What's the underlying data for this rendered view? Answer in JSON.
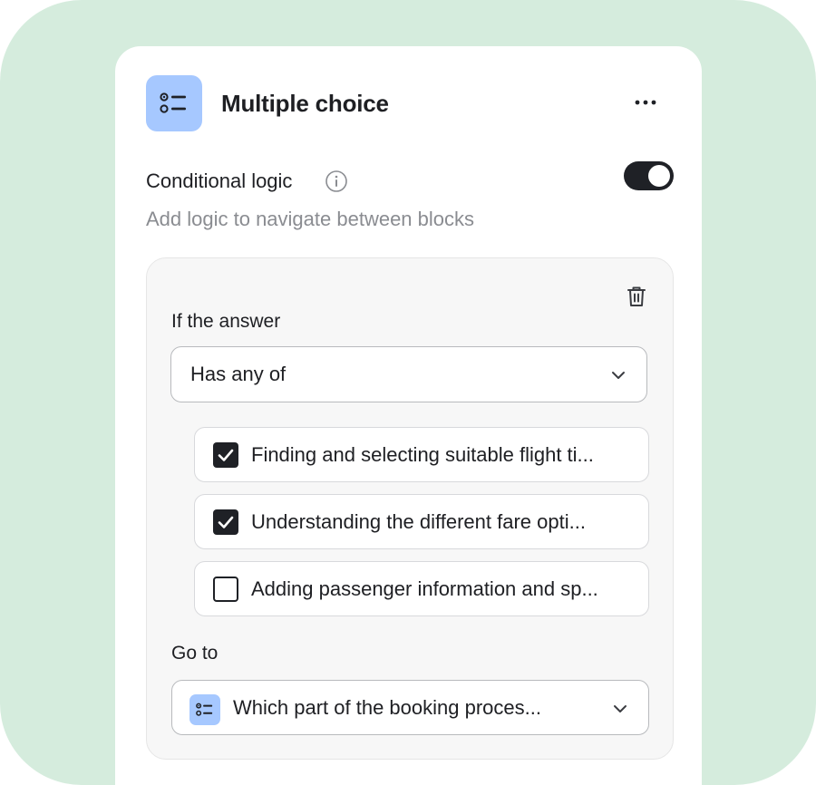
{
  "header": {
    "title": "Multiple choice",
    "icon": "multiple-choice-icon",
    "menu_icon": "more-horizontal-icon"
  },
  "conditional_logic": {
    "label": "Conditional logic",
    "info_icon": "info-icon",
    "enabled": true,
    "description": "Add logic to navigate between blocks"
  },
  "rule": {
    "condition_label": "If the answer",
    "condition_value": "Has any of",
    "options": [
      {
        "label": "Finding and selecting suitable flight ti...",
        "checked": true
      },
      {
        "label": "Understanding the different fare opti...",
        "checked": true
      },
      {
        "label": "Adding passenger information and sp...",
        "checked": false
      }
    ],
    "goto_label": "Go to",
    "goto_value": "Which part of the booking proces...",
    "goto_icon": "multiple-choice-icon",
    "delete_icon": "trash-icon"
  },
  "colors": {
    "background": "#d5ecdd",
    "accent_icon_bg": "#a6c8ff",
    "toggle_on": "#1f2126"
  }
}
